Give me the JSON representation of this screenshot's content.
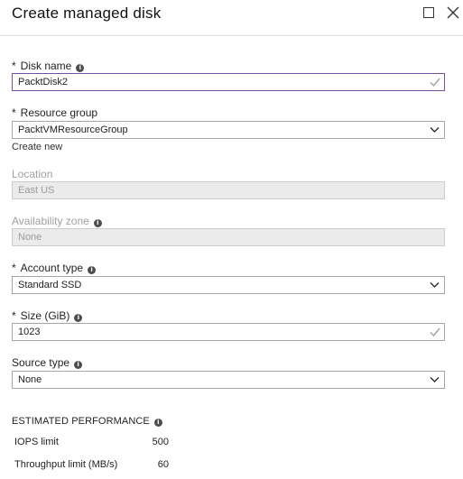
{
  "header": {
    "title": "Create managed disk"
  },
  "form": {
    "disk_name": {
      "label": "Disk name",
      "value": "PacktDisk2"
    },
    "resource_group": {
      "label": "Resource group",
      "value": "PacktVMResourceGroup",
      "create_new": "Create new"
    },
    "location": {
      "label": "Location",
      "value": "East US"
    },
    "availability_zone": {
      "label": "Availability zone",
      "value": "None"
    },
    "account_type": {
      "label": "Account type",
      "value": "Standard SSD"
    },
    "size": {
      "label": "Size (GiB)",
      "value": "1023"
    },
    "source_type": {
      "label": "Source type",
      "value": "None"
    }
  },
  "performance": {
    "heading": "ESTIMATED PERFORMANCE",
    "iops": {
      "label": "IOPS limit",
      "value": "500"
    },
    "throughput": {
      "label": "Throughput limit (MB/s)",
      "value": "60"
    }
  },
  "colors": {
    "focus_border": "#7a4fa0",
    "check_mark": "#a0a0a0",
    "disabled_fill": "#ebebeb"
  }
}
